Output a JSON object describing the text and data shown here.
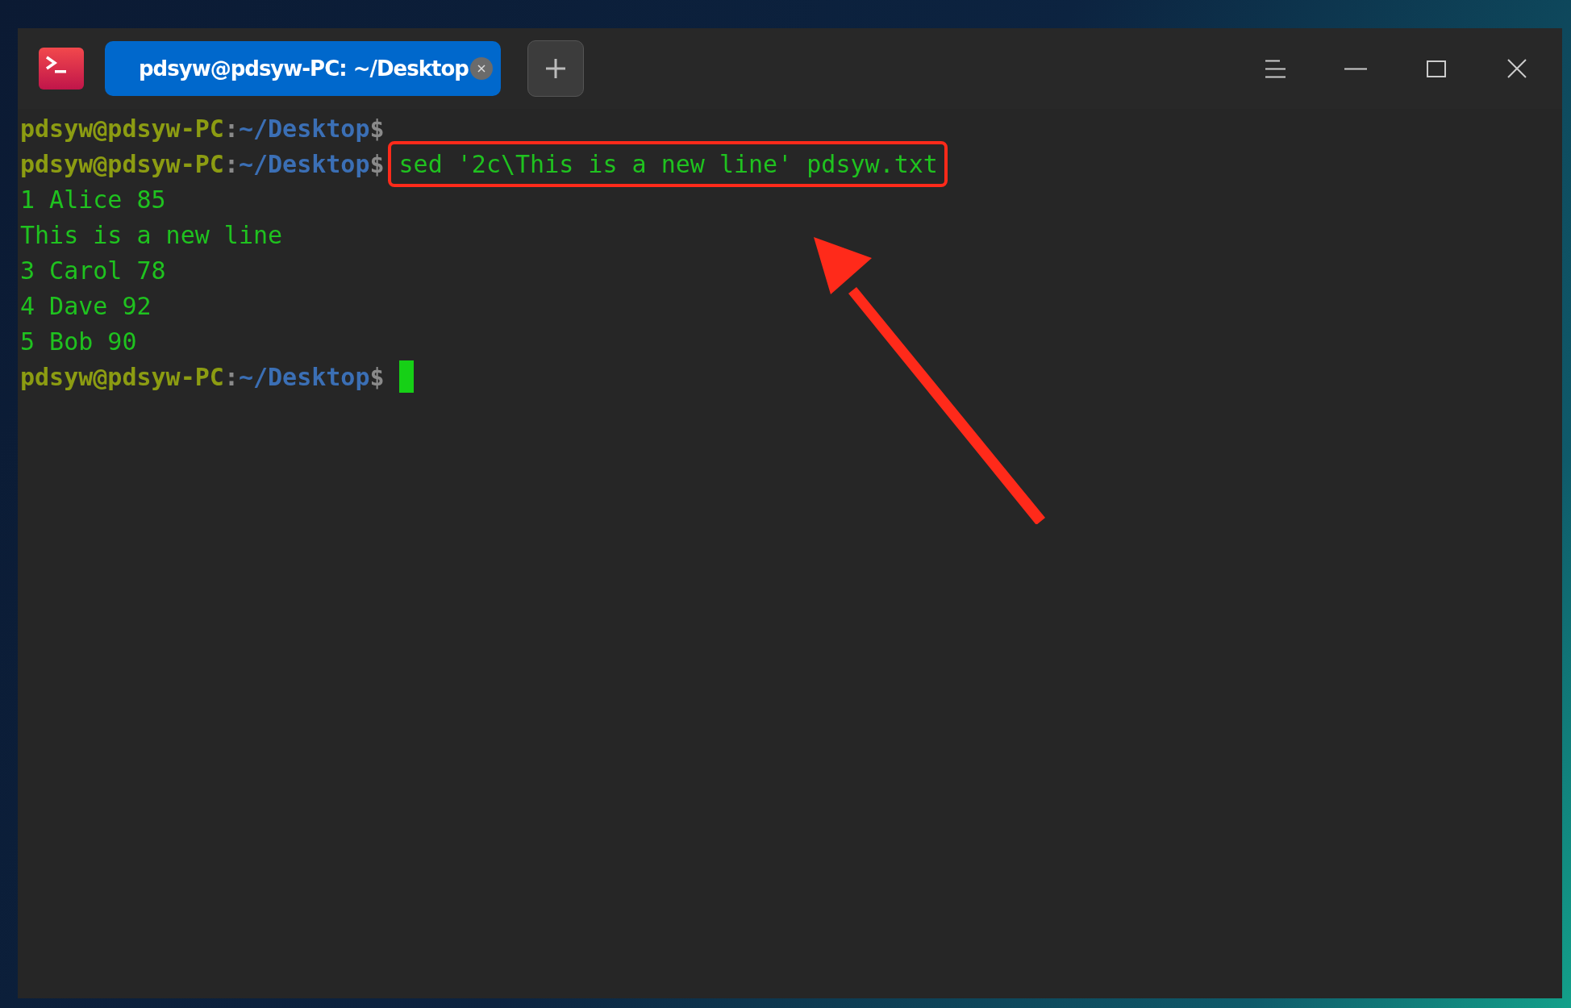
{
  "tab": {
    "title": "pdsyw@pdsyw-PC: ~/Desktop",
    "selected": true
  },
  "lines": [
    {
      "kind": "prompt",
      "user": "pdsyw@pdsyw-PC",
      "separator": ":",
      "path": "~/Desktop",
      "symbol": "$"
    },
    {
      "kind": "prompt",
      "user": "pdsyw@pdsyw-PC",
      "separator": ":",
      "path": "~/Desktop",
      "symbol": "$",
      "command": "sed '2c\\This is a new line' pdsyw.txt",
      "highlighted": true
    },
    {
      "kind": "output",
      "text": "1 Alice 85"
    },
    {
      "kind": "output",
      "text": "This is a new line"
    },
    {
      "kind": "output",
      "text": "3 Carol 78"
    },
    {
      "kind": "output",
      "text": "4 Dave 92"
    },
    {
      "kind": "output",
      "text": "5 Bob 90"
    },
    {
      "kind": "prompt",
      "user": "pdsyw@pdsyw-PC",
      "separator": ":",
      "path": "~/Desktop",
      "symbol": "$",
      "cursor": true
    }
  ]
}
